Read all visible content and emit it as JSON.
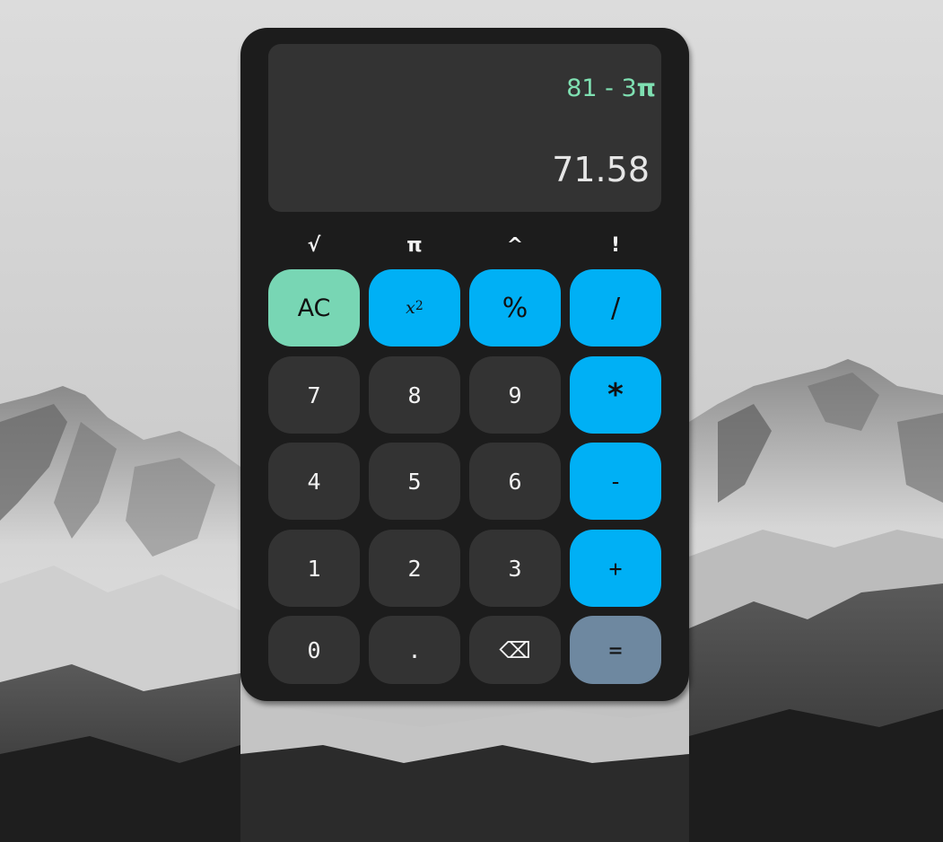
{
  "display": {
    "expression": "81 - 3",
    "expression_symbol": "π",
    "result": "71.58"
  },
  "scientific": [
    {
      "label": "√",
      "name": "sqrt-button"
    },
    {
      "label": "π",
      "name": "pi-button"
    },
    {
      "label": "^",
      "name": "power-button"
    },
    {
      "label": "!",
      "name": "factorial-button"
    }
  ],
  "keys": {
    "ac": "AC",
    "square_base": "x",
    "square_exp": "2",
    "percent": "%",
    "divide": "/",
    "seven": "7",
    "eight": "8",
    "nine": "9",
    "multiply": "*",
    "four": "4",
    "five": "5",
    "six": "6",
    "minus": "-",
    "one": "1",
    "two": "2",
    "three": "3",
    "plus": "+",
    "zero": "0",
    "dot": ".",
    "backspace": "⌫",
    "equals": "="
  },
  "colors": {
    "accent_blue": "#00b0f5",
    "clear_green": "#78d6b4",
    "equals_gray": "#6e88a0",
    "expression_green": "#7fe0b2",
    "body": "#1c1c1c",
    "key_dark": "#333333"
  },
  "background": "snowy-mountains-photo"
}
